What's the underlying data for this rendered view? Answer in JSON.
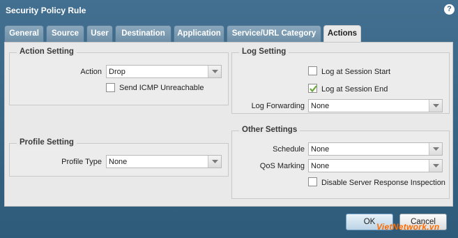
{
  "dialog": {
    "title": "Security Policy Rule",
    "help_icon": "?"
  },
  "tabs": [
    {
      "label": "General"
    },
    {
      "label": "Source"
    },
    {
      "label": "User"
    },
    {
      "label": "Destination"
    },
    {
      "label": "Application"
    },
    {
      "label": "Service/URL Category"
    },
    {
      "label": "Actions",
      "active": true
    }
  ],
  "action_setting": {
    "legend": "Action Setting",
    "action_label": "Action",
    "action_value": "Drop",
    "send_icmp_label": "Send ICMP Unreachable",
    "send_icmp_checked": false
  },
  "profile_setting": {
    "legend": "Profile Setting",
    "profile_type_label": "Profile Type",
    "profile_type_value": "None"
  },
  "log_setting": {
    "legend": "Log Setting",
    "log_start_label": "Log at Session Start",
    "log_start_checked": false,
    "log_end_label": "Log at Session End",
    "log_end_checked": true,
    "log_forwarding_label": "Log Forwarding",
    "log_forwarding_value": "None"
  },
  "other_settings": {
    "legend": "Other Settings",
    "schedule_label": "Schedule",
    "schedule_value": "None",
    "qos_label": "QoS Marking",
    "qos_value": "None",
    "disable_sri_label": "Disable Server Response Inspection",
    "disable_sri_checked": false
  },
  "buttons": {
    "ok": "OK",
    "cancel": "Cancel"
  },
  "watermark": "VietNetwork.vn",
  "colors": {
    "titlebar": "#3c6a8a",
    "check": "#6aa83a",
    "watermark": "#ff6c00"
  }
}
